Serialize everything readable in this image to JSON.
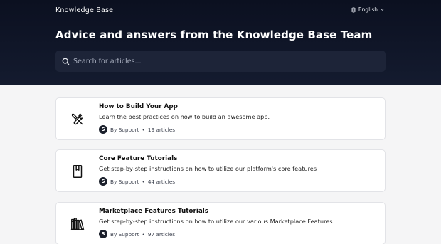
{
  "header": {
    "brand": "Knowledge Base",
    "language": "English",
    "headline": "Advice and answers from the Knowledge Base Team",
    "search_placeholder": "Search for articles..."
  },
  "collections": [
    {
      "icon": "tools-icon",
      "title": "How to Build Your App",
      "description": "Learn the best practices on how to build an awesome app.",
      "avatar_letter": "S",
      "author": "By Support",
      "separator": "•",
      "count": "19 articles"
    },
    {
      "icon": "bookmark-icon",
      "title": "Core Feature Tutorials",
      "description": "Get step-by-step instructions on how to utilize our platform's core features",
      "avatar_letter": "S",
      "author": "By Support",
      "separator": "•",
      "count": "44 articles"
    },
    {
      "icon": "books-icon",
      "title": "Marketplace Features Tutorials",
      "description": "Get step-by-step instructions on how to utilize our various Marketplace Features",
      "avatar_letter": "S",
      "author": "By Support",
      "separator": "•",
      "count": "97 articles"
    }
  ],
  "colors": {
    "hero_bg": "#0b1020",
    "search_bg": "#1d2438",
    "page_bg": "#f5f5f6",
    "card_bg": "#ffffff"
  }
}
